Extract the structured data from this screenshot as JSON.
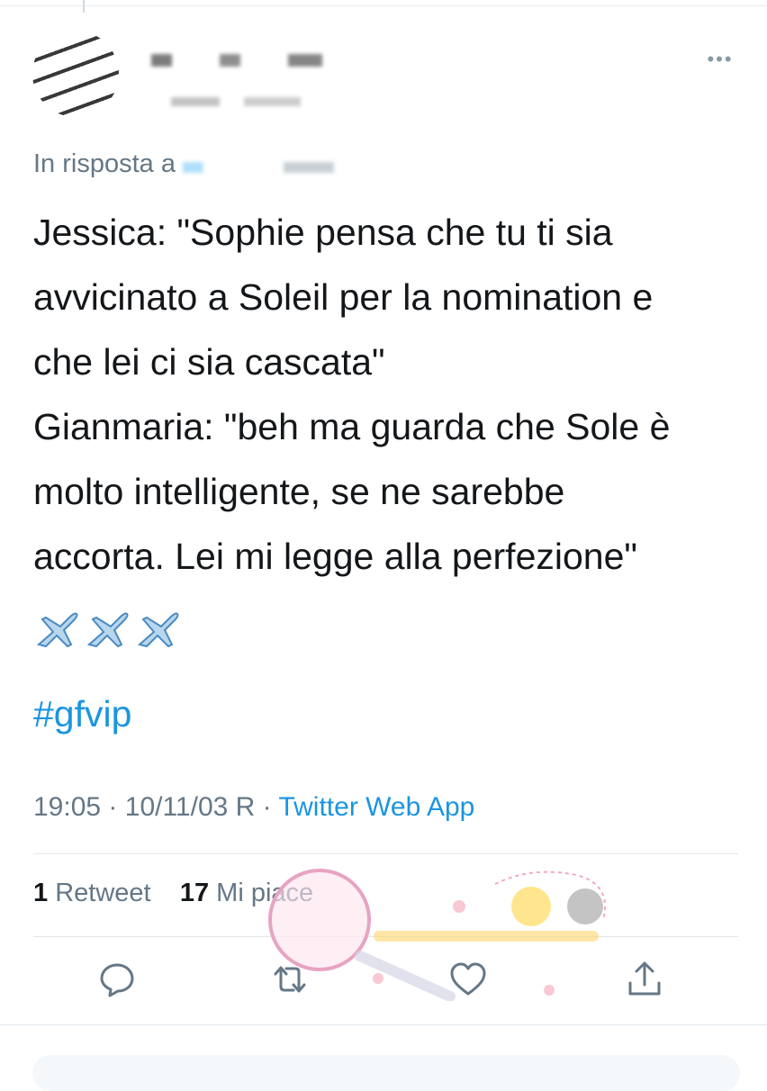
{
  "tweet": {
    "reply_prefix": "In risposta a",
    "lines": [
      "Jessica: \"Sophie pensa che tu ti sia",
      "avvicinato a Soleil per la nomination e",
      "che lei ci sia cascata\"",
      "Gianmaria: \"beh ma guarda che Sole è",
      "molto intelligente, se ne sarebbe",
      "accorta. Lei mi legge alla perfezione\""
    ],
    "hashtag": "#gfvip",
    "time": "19:05",
    "separator": "·",
    "date": "10/11/03 R",
    "source": "Twitter Web App"
  },
  "stats": {
    "retweet_count": "1",
    "retweet_label": "Retweet",
    "like_count": "17",
    "like_label": "Mi piace"
  },
  "icons": {
    "more": "more-options-icon",
    "reply": "reply-icon",
    "retweet": "retweet-icon",
    "like": "heart-icon",
    "share": "share-icon",
    "emoji": "airplane-emoji"
  },
  "colors": {
    "link": "#1b95e0",
    "secondary_text": "#657786",
    "primary_text": "#14171a",
    "divider": "#e1e8ed"
  }
}
